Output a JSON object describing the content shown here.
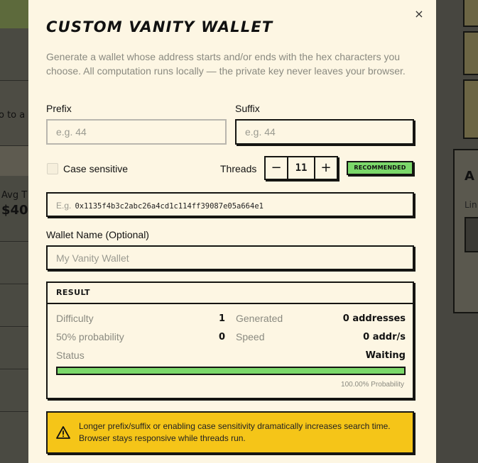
{
  "background": {
    "left_snippet": "o to a",
    "avg_label": "Avg T",
    "avg_value": "$40",
    "right_letter": "A",
    "right_sub": "Lin"
  },
  "modal": {
    "title": "Custom Vanity Wallet",
    "close_glyph": "×",
    "description": "Generate a wallet whose address starts and/or ends with the hex characters you choose. All computation runs locally — the private key never leaves your browser.",
    "prefix": {
      "label": "Prefix",
      "placeholder": "e.g. 44",
      "value": ""
    },
    "suffix": {
      "label": "Suffix",
      "placeholder": "e.g. 44",
      "value": ""
    },
    "case_sensitive": {
      "label": "Case sensitive",
      "checked": false
    },
    "threads": {
      "label": "Threads",
      "minus": "−",
      "plus": "+",
      "value": "11",
      "badge": "RECOMMENDED"
    },
    "example": {
      "prefix": "E.g.",
      "address": "0x1135f4b3c2abc26a4cd1c114ff39087e05a664e1"
    },
    "wallet_name": {
      "label": "Wallet Name (Optional)",
      "placeholder": "My Vanity Wallet",
      "value": ""
    },
    "result": {
      "heading": "RESULT",
      "difficulty": {
        "label": "Difficulty",
        "value": "1"
      },
      "generated": {
        "label": "Generated",
        "value": "0 addresses"
      },
      "probability50": {
        "label": "50% probability",
        "value": "0"
      },
      "speed": {
        "label": "Speed",
        "value": "0 addr/s"
      },
      "status": {
        "label": "Status",
        "value": "Waiting"
      },
      "progress_percent": 100,
      "probability_text": "100.00% Probability"
    },
    "warning": {
      "icon": "warning-triangle-icon",
      "text": "Longer prefix/suffix or enabling case sensitivity dramatically increases search time. Browser stays responsive while threads run."
    }
  },
  "colors": {
    "modal_bg": "#fdf6e3",
    "border": "#151512",
    "accent_green": "#7bd86a",
    "warning_yellow": "#f5c518",
    "muted_text": "#8a8a80"
  }
}
